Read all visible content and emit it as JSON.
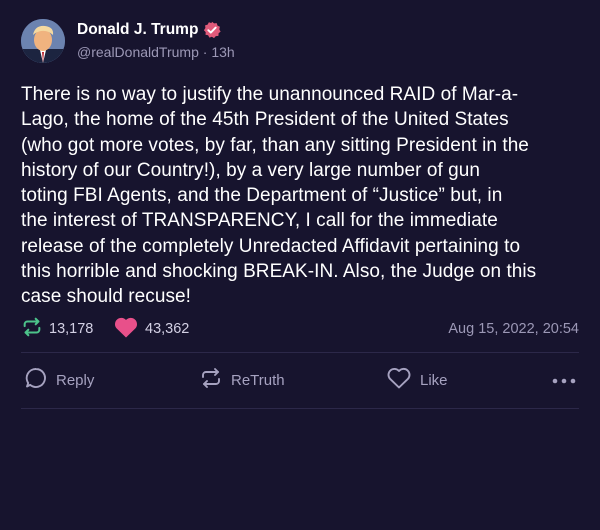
{
  "author": {
    "display_name": "Donald J. Trump",
    "handle": "@realDonaldTrump",
    "time_ago": "13h",
    "separator": "·",
    "verified_color": "#e05a7a"
  },
  "post": {
    "text": "There is no way to justify the unannounced RAID of Mar-a-\nLago, the home of the 45th President of the United States\n(who got more votes, by far, than any sitting President in the\nhistory of our Country!), by a very large number of gun\ntoting FBI Agents, and the Department of “Justice” but, in\nthe interest of TRANSPARENCY, I call for the immediate\nrelease of the completely Unredacted Affidavit pertaining to\nthis horrible and shocking BREAK-IN. Also, the Judge on this\ncase should recuse!"
  },
  "stats": {
    "retruths": "13,178",
    "likes": "43,362",
    "timestamp": "Aug 15, 2022, 20:54",
    "retruth_color": "#4cc38a",
    "like_color": "#e8508a"
  },
  "actions": {
    "reply": "Reply",
    "retruth": "ReTruth",
    "like": "Like"
  },
  "icons": {
    "verified": "verified-badge-icon",
    "retruth_stat": "retruth-icon",
    "like_stat": "heart-icon",
    "reply": "speech-bubble-icon",
    "retruth_action": "retruth-icon",
    "like_action": "heart-outline-icon",
    "more": "more-dots-icon"
  },
  "colors": {
    "background": "#17142e",
    "muted_text": "#9c98b6",
    "divider": "#2c2849"
  }
}
